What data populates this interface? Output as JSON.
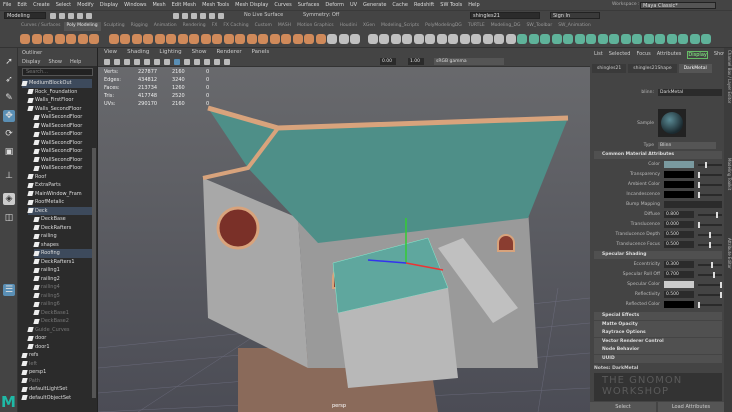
{
  "menubar": [
    "File",
    "Edit",
    "Create",
    "Select",
    "Modify",
    "Display",
    "Windows",
    "Mesh",
    "Edit Mesh",
    "Mesh Tools",
    "Mesh Display",
    "Curves",
    "Surfaces",
    "Deform",
    "UV",
    "Generate",
    "Cache",
    "Redshift",
    "SW Tools",
    "Help"
  ],
  "status": {
    "mode": "Modeling",
    "live_surface": "No Live Surface",
    "symmetry": "Symmetry: Off",
    "object_name": "shingles21",
    "sign_in": "Sign In",
    "workspace_label": "Workspace :",
    "workspace": "Maya Classic*"
  },
  "shelf_tabs": [
    "Curves / Surfaces",
    "Poly Modeling",
    "Sculpting",
    "Rigging",
    "Animation",
    "Rendering",
    "FX",
    "FX Caching",
    "Custom",
    "MASH",
    "Motion Graphics",
    "Houdini",
    "XGen",
    "Modeling_Scripts",
    "PolyModelingDG",
    "TURTLE",
    "Modeling_DG",
    "SW_Toolbar",
    "SW_Animation"
  ],
  "shelf_active": 1,
  "outliner": {
    "title": "Outliner",
    "menu": [
      "Display",
      "Show",
      "Help"
    ],
    "search_placeholder": "Search...",
    "items": [
      {
        "label": "MediumBlockOut",
        "d": 0,
        "s": "hl"
      },
      {
        "label": "Rock_Foundation",
        "d": 1
      },
      {
        "label": "Walls_FirstFloor",
        "d": 1
      },
      {
        "label": "Walls_SecondFloor",
        "d": 1
      },
      {
        "label": "WallSecondFloor",
        "d": 2
      },
      {
        "label": "WallSecondFloor",
        "d": 2
      },
      {
        "label": "WallSecondFloor",
        "d": 2
      },
      {
        "label": "WallSecondFloor",
        "d": 2
      },
      {
        "label": "WallSecondFloor",
        "d": 2
      },
      {
        "label": "WallSecondFloor",
        "d": 2
      },
      {
        "label": "WallSecondFloor",
        "d": 2
      },
      {
        "label": "Roof",
        "d": 1
      },
      {
        "label": "ExtraParts",
        "d": 1
      },
      {
        "label": "MainWindow_Fram",
        "d": 1
      },
      {
        "label": "RoofMetalic",
        "d": 1
      },
      {
        "label": "Deck",
        "d": 1,
        "s": "hl"
      },
      {
        "label": "DeckBase",
        "d": 2
      },
      {
        "label": "DeckRafters",
        "d": 2
      },
      {
        "label": "railing",
        "d": 2
      },
      {
        "label": "shapes",
        "d": 2
      },
      {
        "label": "Roofing",
        "d": 2,
        "s": "hl"
      },
      {
        "label": "DeckRafters1",
        "d": 2
      },
      {
        "label": "railing1",
        "d": 2
      },
      {
        "label": "railing2",
        "d": 2
      },
      {
        "label": "railing4",
        "d": 2,
        "s": "dim"
      },
      {
        "label": "railing5",
        "d": 2,
        "s": "dim"
      },
      {
        "label": "railing6",
        "d": 2,
        "s": "dim"
      },
      {
        "label": "DeckBase1",
        "d": 2,
        "s": "dim"
      },
      {
        "label": "DeckBase2",
        "d": 2,
        "s": "dim"
      },
      {
        "label": "Guide_Curves",
        "d": 1,
        "s": "dim"
      },
      {
        "label": "door",
        "d": 1
      },
      {
        "label": "door1",
        "d": 1
      },
      {
        "label": "refs",
        "d": 0
      },
      {
        "label": "left",
        "d": 0,
        "s": "dim"
      },
      {
        "label": "persp1",
        "d": 0
      },
      {
        "label": "Path",
        "d": 0,
        "s": "dim"
      },
      {
        "label": "defaultLightSet",
        "d": 0
      },
      {
        "label": "defaultObjectSet",
        "d": 0
      }
    ]
  },
  "viewport": {
    "menu": [
      "View",
      "Shading",
      "Lighting",
      "Show",
      "Renderer",
      "Panels"
    ],
    "exposure": "0.00",
    "gamma": "1.00",
    "color_space": "sRGB gamma",
    "camera": "persp",
    "hud": [
      [
        "Verts:",
        "227877",
        "2160",
        "0"
      ],
      [
        "Edges:",
        "434812",
        "3240",
        "0"
      ],
      [
        "Faces:",
        "213734",
        "1260",
        "0"
      ],
      [
        "Tris:",
        "417748",
        "2520",
        "0"
      ],
      [
        "UVs:",
        "290170",
        "2160",
        "0"
      ]
    ]
  },
  "attr": {
    "tabs": [
      "List",
      "Selected",
      "Focus",
      "Attributes",
      "Display",
      "Show"
    ],
    "active_tab": "Display",
    "node_tabs": [
      "shingles21",
      "shingles21Shape",
      "DarkMetal"
    ],
    "active_node": "DarkMetal",
    "type_label": "blinn:",
    "name": "DarkMetal",
    "sample_label": "Sample",
    "type_field": "Type",
    "type": "Blinn",
    "common_section": "Common Material Attributes",
    "common": [
      {
        "label": "Color",
        "kind": "color",
        "color": "#7a9aa0",
        "v": 0.3
      },
      {
        "label": "Transparency",
        "kind": "color",
        "color": "#000000",
        "v": 0
      },
      {
        "label": "Ambient Color",
        "kind": "color",
        "color": "#000000",
        "v": 0
      },
      {
        "label": "Incandescence",
        "kind": "color",
        "color": "#000000",
        "v": 0
      },
      {
        "label": "Bump Mapping",
        "kind": "map"
      },
      {
        "label": "Diffuse",
        "kind": "num",
        "value": "0.800",
        "v": 0.8
      },
      {
        "label": "Translucence",
        "kind": "num",
        "value": "0.000",
        "v": 0
      },
      {
        "label": "Translucence Depth",
        "kind": "num",
        "value": "0.500",
        "v": 0.5
      },
      {
        "label": "Translucence Focus",
        "kind": "num",
        "value": "0.500",
        "v": 0.5
      }
    ],
    "spec_section": "Specular Shading",
    "spec": [
      {
        "label": "Eccentricity",
        "kind": "num",
        "value": "0.300",
        "v": 0.6
      },
      {
        "label": "Specular Roll Off",
        "kind": "num",
        "value": "0.700",
        "v": 0.7
      },
      {
        "label": "Specular Color",
        "kind": "color",
        "color": "#cccccc",
        "v": 1
      },
      {
        "label": "Reflectivity",
        "kind": "num",
        "value": "0.500",
        "v": 1
      },
      {
        "label": "Reflected Color",
        "kind": "color",
        "color": "#000000",
        "v": 0
      }
    ],
    "collapsed": [
      "Special Effects",
      "Matte Opacity",
      "Raytrace Options",
      "Vector Renderer Control",
      "Node Behavior",
      "UUID"
    ],
    "notes": "Notes: DarkMetal",
    "select": "Select",
    "load": "Load Attributes"
  },
  "side_tabs": [
    "Channel Box / Layer Editor",
    "Modeling Toolkit",
    "Attribute Editor"
  ],
  "watermark": "THE GNOMON WORKSHOP"
}
